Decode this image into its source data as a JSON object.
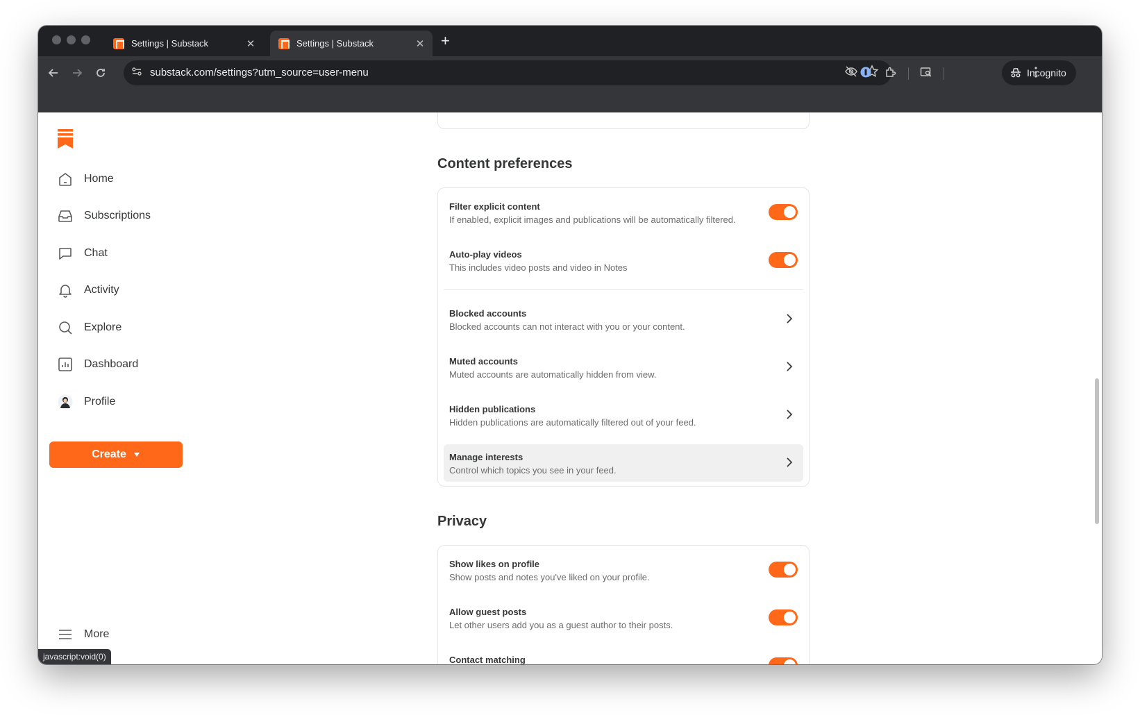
{
  "browser": {
    "tabs": [
      {
        "title": "Settings | Substack",
        "active": false
      },
      {
        "title": "Settings | Substack",
        "active": true
      }
    ],
    "new_tab_symbol": "+",
    "close_symbol": "✕",
    "url": "substack.com/settings?utm_source=user-menu",
    "incognito_label": "Incognito",
    "status_url": "javascript:void(0)"
  },
  "colors": {
    "accent": "#ff6719",
    "text": "#363737",
    "muted": "#6b6b6b"
  },
  "sidebar": {
    "items": [
      {
        "label": "Home",
        "icon": "home-icon"
      },
      {
        "label": "Subscriptions",
        "icon": "inbox-icon"
      },
      {
        "label": "Chat",
        "icon": "chat-icon"
      },
      {
        "label": "Activity",
        "icon": "bell-icon"
      },
      {
        "label": "Explore",
        "icon": "search-icon"
      },
      {
        "label": "Dashboard",
        "icon": "dashboard-icon"
      },
      {
        "label": "Profile",
        "icon": "avatar"
      }
    ],
    "create_label": "Create",
    "more_label": "More"
  },
  "content_preferences": {
    "title": "Content preferences",
    "toggles": [
      {
        "label": "Filter explicit content",
        "desc": "If enabled, explicit images and publications will be automatically filtered.",
        "on": true
      },
      {
        "label": "Auto-play videos",
        "desc": "This includes video posts and video in Notes",
        "on": true
      }
    ],
    "links": [
      {
        "label": "Blocked accounts",
        "desc": "Blocked accounts can not interact with you or your content."
      },
      {
        "label": "Muted accounts",
        "desc": "Muted accounts are automatically hidden from view."
      },
      {
        "label": "Hidden publications",
        "desc": "Hidden publications are automatically filtered out of your feed."
      },
      {
        "label": "Manage interests",
        "desc": "Control which topics you see in your feed."
      }
    ]
  },
  "privacy": {
    "title": "Privacy",
    "toggles": [
      {
        "label": "Show likes on profile",
        "desc": "Show posts and notes you've liked on your profile.",
        "on": true
      },
      {
        "label": "Allow guest posts",
        "desc": "Let other users add you as a guest author to their posts.",
        "on": true
      },
      {
        "label": "Contact matching",
        "desc": "",
        "on": true
      }
    ]
  }
}
